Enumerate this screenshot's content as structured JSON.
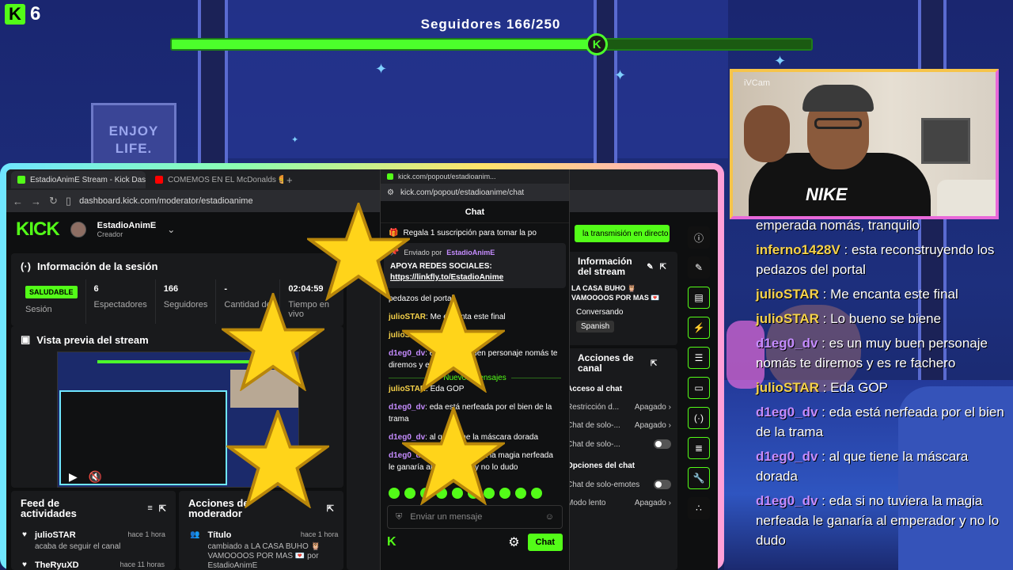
{
  "overlay": {
    "logo_number": "6",
    "goal_label": "Seguidores 166/250",
    "goal_progress": 0.664,
    "poster_text": "ENJOY LIFE.",
    "cam_label": "iVCam",
    "cam_shirt": "NIKE",
    "chat": [
      {
        "user": "",
        "text": "emperada nomás, tranquilo",
        "color": "#ffffff"
      },
      {
        "user": "inferno1428V",
        "text": "esta reconstruyendo los pedazos del portal",
        "color": "#f6d24a"
      },
      {
        "user": "julioSTAR",
        "text": "Me encanta este final",
        "color": "#f6d24a"
      },
      {
        "user": "julioSTAR",
        "text": "Lo bueno se biene",
        "color": "#f6d24a"
      },
      {
        "user": "d1eg0_dv",
        "text": "es un muy buen personaje nomás te diremos y es re fachero",
        "color": "#c58cff"
      },
      {
        "user": "julioSTAR",
        "text": "Eda GOP",
        "color": "#f6d24a"
      },
      {
        "user": "d1eg0_dv",
        "text": "eda está nerfeada por el bien de la trama",
        "color": "#c58cff"
      },
      {
        "user": "d1eg0_dv",
        "text": "al que tiene la máscara dorada",
        "color": "#c58cff"
      },
      {
        "user": "d1eg0_dv",
        "text": "eda si no tuviera la magia nerfeada le ganaría al emperador y no lo dudo",
        "color": "#c58cff"
      }
    ]
  },
  "browser": {
    "tabs": [
      {
        "label": "EstadioAnimE Stream - Kick Dash",
        "active": true
      },
      {
        "label": "COMEMOS EN EL McDonalds 🍔",
        "active": false
      }
    ],
    "url": "dashboard.kick.com/moderator/estadioanime"
  },
  "dashboard": {
    "logo": "KICK",
    "channel_name": "EstadioAnimE",
    "channel_role": "Creador",
    "session_title": "Información de la sesión",
    "health_badge": "SALUDABLE",
    "stats": [
      {
        "value": "",
        "label": "Sesión"
      },
      {
        "value": "6",
        "label": "Espectadores"
      },
      {
        "value": "166",
        "label": "Seguidores"
      },
      {
        "value": "-",
        "label": "Cantidad de suscripción"
      },
      {
        "value": "02:04:59",
        "label": "Tiempo en vivo"
      }
    ],
    "preview_title": "Vista previa del stream",
    "feed_title": "Feed de actividades",
    "feed": [
      {
        "user": "julioSTAR",
        "time": "hace 1 hora",
        "sub": "acaba de seguir el canal"
      },
      {
        "user": "TheRyuXD",
        "time": "hace 11 horas",
        "sub": ""
      }
    ],
    "mod_title": "Acciones de moderador",
    "mod": [
      {
        "title": "Título",
        "time": "hace 1 hora",
        "sub": "cambiado a LA CASA BUHO 🦉 VAMOOOOS POR MAS 💌 por EstadioAnimE"
      }
    ],
    "live_button": "la transmisión en directo",
    "stream_info_title": "Información del stream",
    "stream_info_value": "LA CASA BUHO 🦉 VAMOOOOS POR MAS 💌",
    "category": "Conversando",
    "language": "Spanish",
    "channel_actions_title": "Acciones de canal",
    "chat_access_title": "Acceso al chat",
    "chat_access": [
      {
        "label": "Restricción d...",
        "value": "Apagado",
        "type": "select"
      },
      {
        "label": "Chat de solo-...",
        "value": "Apagado",
        "type": "select"
      },
      {
        "label": "Chat de solo-...",
        "value": "",
        "type": "toggle"
      }
    ],
    "chat_options_title": "Opciones del chat",
    "chat_options": [
      {
        "label": "Chat de solo-emotes",
        "value": "",
        "type": "toggle"
      },
      {
        "label": "Modo lento",
        "value": "Apagado",
        "type": "select"
      }
    ]
  },
  "popout": {
    "window_title": "kick.com/popout/estadioanim...",
    "url": "kick.com/popout/estadioanime/chat",
    "header": "Chat",
    "gift_text": "Regala 1 suscripción para tomar la po",
    "pinned_by_label": "Enviado por",
    "pinned_by_user": "EstadioAnimE",
    "pinned_text": "APOYA REDES SOCIALES:",
    "pinned_link": "https://linkfly.to/EstadioAnime",
    "messages": [
      {
        "user": "",
        "text": "pedazos del portal",
        "color": "#ffffff"
      },
      {
        "user": "julioSTAR",
        "text": "Me encanta este final",
        "color": "#f6d24a"
      },
      {
        "user": "julioSTAR",
        "text": "Lo bueno se biene",
        "color": "#f6d24a"
      },
      {
        "user": "d1eg0_dv",
        "text": "es un muy buen personaje nomás te diremos y es re fachero",
        "color": "#c58cff"
      }
    ],
    "new_messages_label": "Nuevos mensajes",
    "messages_after": [
      {
        "user": "julioSTAR",
        "text": "Eda GOP",
        "color": "#f6d24a"
      },
      {
        "user": "d1eg0_dv",
        "text": "eda está nerfeada por el bien de la trama",
        "color": "#c58cff"
      },
      {
        "user": "d1eg0_dv",
        "text": "al que tiene la máscara dorada",
        "color": "#c58cff"
      },
      {
        "user": "d1eg0_dv",
        "text": "eda si no tuviera la magia nerfeada le ganaría al emperador y no lo dudo",
        "color": "#c58cff"
      }
    ],
    "input_placeholder": "Enviar un mensaje",
    "send_label": "Chat"
  },
  "icons": [
    "kick-icon",
    "gear-icon",
    "pin-icon",
    "smile-icon",
    "star-icon",
    "shield-icon",
    "info-icon",
    "pencil-icon",
    "chevron-right-icon",
    "users-icon"
  ],
  "colors": {
    "kick_green": "#53fc18",
    "gold_user": "#f6d24a",
    "purple_user": "#c58cff"
  }
}
